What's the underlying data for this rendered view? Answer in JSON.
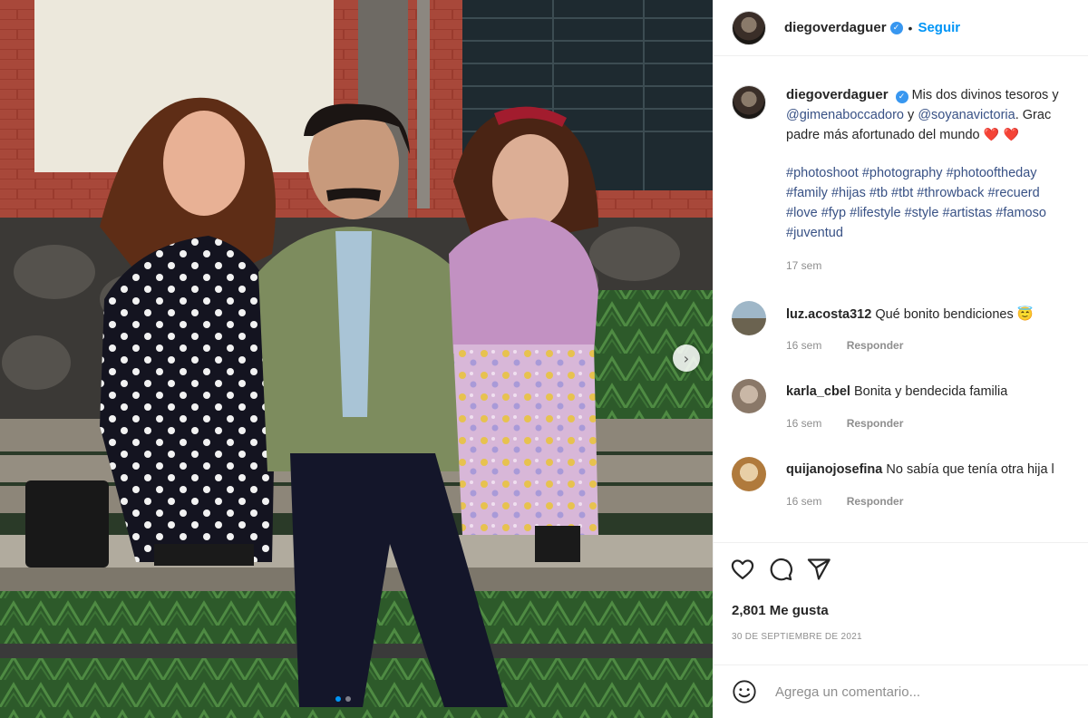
{
  "post": {
    "username": "diegoverdaguer",
    "follow_label": "Seguir",
    "separator": "•",
    "verified_mark": "✓"
  },
  "caption": {
    "username": "diegoverdaguer",
    "line1_text": "Mis dos divinos tesoros y",
    "mention1": "@gimenaboccadoro",
    "line2_mid": " y ",
    "mention2": "@soyanavictoria",
    "line2_end": ". Grac",
    "line3_text": "padre más afortunado del mundo ",
    "hearts": "❤️ ❤️",
    "hashtag_lines": [
      "#photoshoot #photography #photooftheday",
      "#family #hijas #tb #tbt #throwback #recuerd",
      "#love #fyp #lifestyle #style #artistas #famoso",
      "#juventud"
    ],
    "age": "17 sem"
  },
  "comments": [
    {
      "user": "luz.acosta312",
      "text": "Qué bonito bendiciones 😇",
      "age": "16 sem",
      "reply": "Responder"
    },
    {
      "user": "karla_cbel",
      "text": "Bonita y bendecida familia",
      "age": "16 sem",
      "reply": "Responder"
    },
    {
      "user": "quijanojosefina",
      "text": "No sabía que tenía otra hija l",
      "age": "16 sem",
      "reply": "Responder"
    }
  ],
  "actions": {
    "likes": "2,801 Me gusta",
    "date": "30 DE SEPTIEMBRE DE 2021",
    "icons": [
      "heart-icon",
      "comment-icon",
      "share-icon"
    ]
  },
  "add_comment": {
    "placeholder": "Agrega un comentario..."
  },
  "carousel": {
    "next_glyph": "›",
    "slide_count": 2,
    "active_slide": 1
  },
  "colors": {
    "link": "#0095f6",
    "mention": "#385185",
    "muted": "#8e8e8e",
    "verified": "#3897f0"
  }
}
